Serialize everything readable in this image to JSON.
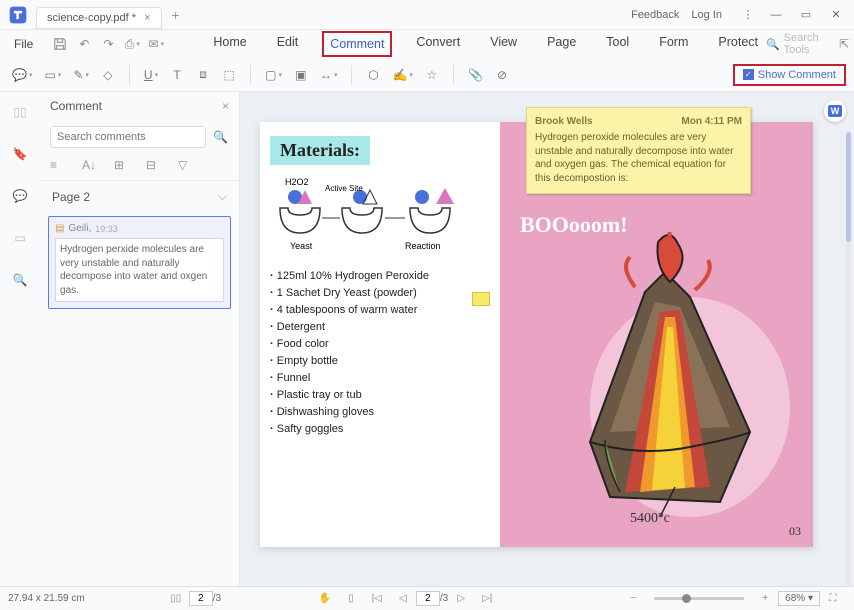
{
  "titlebar": {
    "filename": "science-copy.pdf *",
    "feedback": "Feedback",
    "login": "Log In"
  },
  "menubar": {
    "file": "File",
    "items": [
      "Home",
      "Edit",
      "Comment",
      "Convert",
      "View",
      "Page",
      "Tool",
      "Form",
      "Protect"
    ],
    "search_ph": "Search Tools"
  },
  "ribbon": {
    "show_comment": "Show Comment"
  },
  "sidebar": {
    "title": "Comment",
    "search_ph": "Search comments",
    "page_label": "Page 2",
    "comment": {
      "author": "Geili,",
      "time": "19:33",
      "body": "Hydrogen perxide molecules are very unstable and naturally decompose into water and oxgen gas."
    }
  },
  "popup": {
    "author": "Brook Wells",
    "time": "Mon 4:11 PM",
    "body": "Hydrogen peroxide molecules are very unstable and naturally decompose into water and oxygen gas. The chemical equation for this decompostion is:"
  },
  "doc": {
    "materials_title": "Materials:",
    "sketch": {
      "h2o2": "H2O2",
      "active": "Active Site",
      "yeast": "Yeast",
      "reaction": "Reaction"
    },
    "list": [
      "125ml 10% Hydrogen Peroxide",
      "1 Sachet Dry Yeast (powder)",
      "4 tablespoons of warm water",
      "Detergent",
      "Food color",
      "Empty bottle",
      "Funnel",
      "Plastic tray or tub",
      "Dishwashing gloves",
      "Safty goggles"
    ],
    "boom": "BOOooom!",
    "temp": "5400°c",
    "pagenum": "03"
  },
  "status": {
    "dims": "27.94 x 21.59 cm",
    "page_cur": "2",
    "page_total": "/3",
    "zoom": "68%"
  }
}
